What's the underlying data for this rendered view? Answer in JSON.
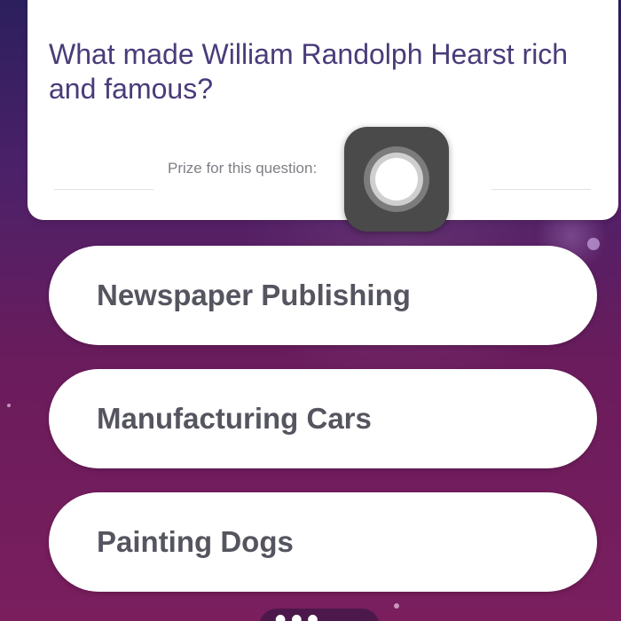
{
  "question": {
    "text": "What made William Randolph Hearst rich and famous?",
    "prize_label": "Prize for this question:"
  },
  "answers": [
    {
      "label": "Newspaper Publishing"
    },
    {
      "label": "Manufacturing Cars"
    },
    {
      "label": "Painting Dogs"
    }
  ],
  "overlay": {
    "icon": "assistive-touch-icon"
  },
  "colors": {
    "background_top": "#2c1f5e",
    "background_bottom": "#7a1e5e",
    "question_text": "#4a3b7a",
    "answer_text": "#555560",
    "card": "#ffffff"
  }
}
